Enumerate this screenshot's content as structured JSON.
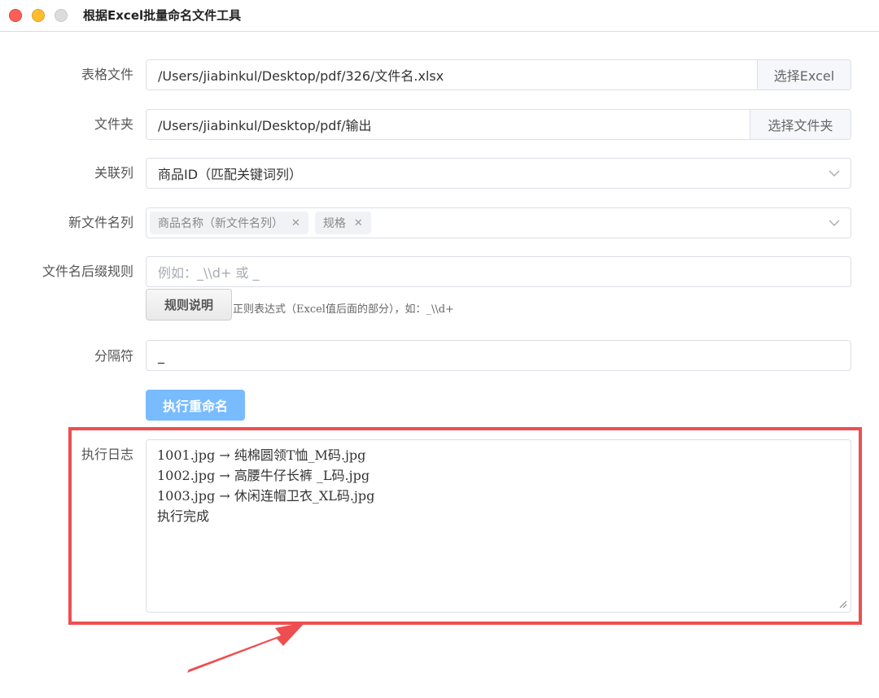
{
  "window": {
    "title": "根据Excel批量命名文件工具"
  },
  "form": {
    "excel": {
      "label": "表格文件",
      "value": "/Users/jiabinkul/Desktop/pdf/326/文件名.xlsx",
      "button": "选择Excel"
    },
    "folder": {
      "label": "文件夹",
      "value": "/Users/jiabinkul/Desktop/pdf/输出",
      "button": "选择文件夹"
    },
    "match_column": {
      "label": "关联列",
      "value": "商品ID（匹配关键词列）"
    },
    "new_name_columns": {
      "label": "新文件名列",
      "tags": [
        "商品名称（新文件名列）",
        "规格"
      ]
    },
    "suffix_rule": {
      "label": "文件名后缀规则",
      "placeholder": "例如：_\\\\d+ 或 _",
      "help_button": "规则说明",
      "hint": "正则表达式（Excel值后面的部分），如：_\\\\d+"
    },
    "separator": {
      "label": "分隔符",
      "value": "_"
    },
    "run_button": "执行重命名",
    "log": {
      "label": "执行日志",
      "lines": [
        "1001.jpg → 纯棉圆领T恤_M码.jpg",
        "1002.jpg → 高腰牛仔长裤 _L码.jpg",
        "1003.jpg → 休闲连帽卫衣_XL码.jpg",
        "执行完成"
      ]
    }
  },
  "annotation": {
    "color": "#ee4e50"
  }
}
